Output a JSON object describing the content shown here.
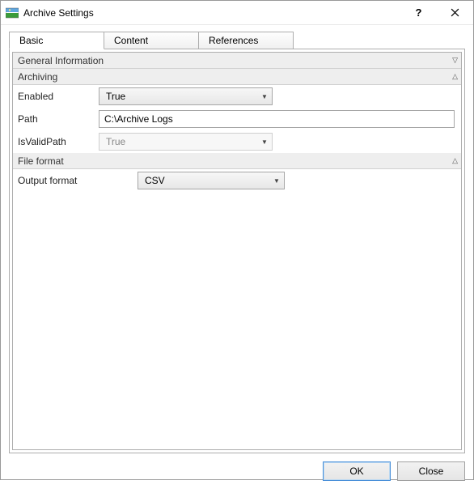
{
  "window": {
    "title": "Archive Settings"
  },
  "tabs": {
    "basic": "Basic",
    "content": "Content",
    "references": "References"
  },
  "categories": {
    "general": "General Information",
    "archiving": "Archiving",
    "fileformat": "File format"
  },
  "archiving": {
    "enabled_label": "Enabled",
    "enabled_value": "True",
    "path_label": "Path",
    "path_value": "C:\\Archive Logs",
    "isvalid_label": "IsValidPath",
    "isvalid_value": "True"
  },
  "fileformat": {
    "output_label": "Output format",
    "output_value": "CSV"
  },
  "buttons": {
    "ok": "OK",
    "close": "Close"
  }
}
